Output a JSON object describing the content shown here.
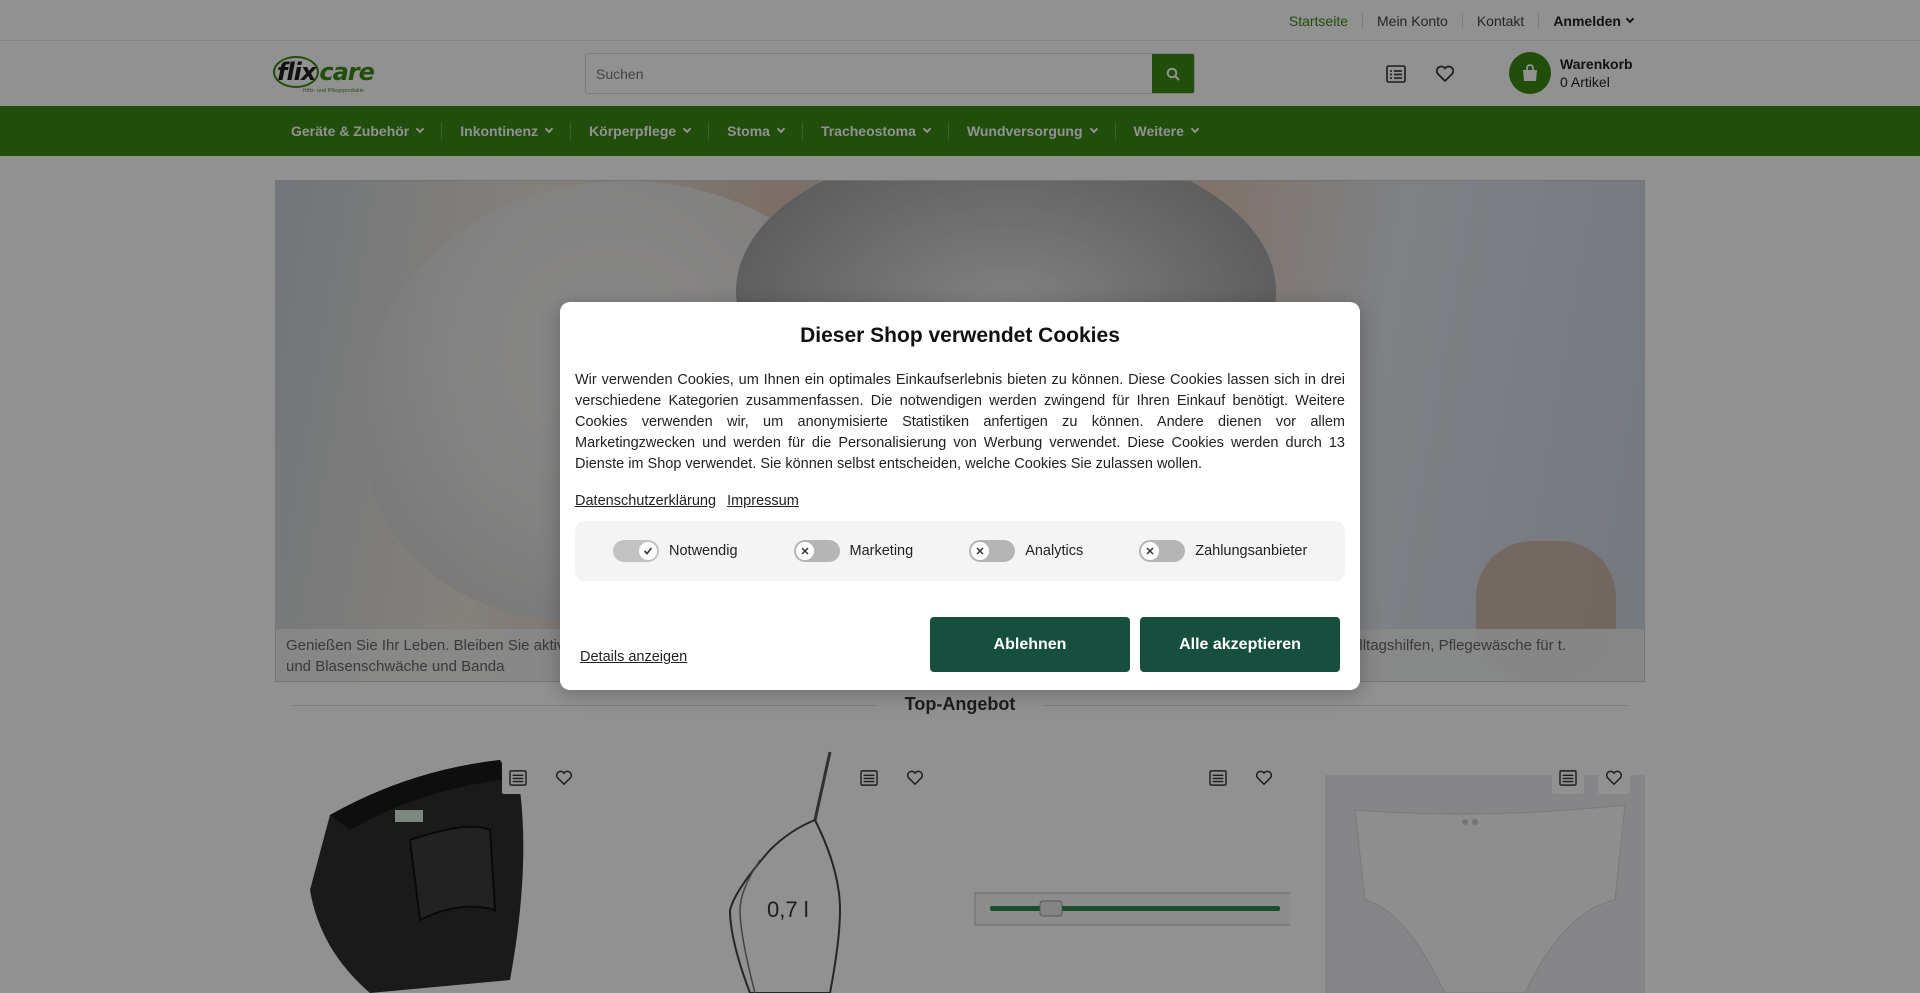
{
  "topbar": {
    "home": "Startseite",
    "account": "Mein Konto",
    "contact": "Kontakt",
    "login": "Anmelden"
  },
  "header": {
    "logo_text_1": "flix",
    "logo_text_2": "care",
    "logo_tagline": "Hilfs- und Pflegeprodukte",
    "search_placeholder": "Suchen",
    "cart_title": "Warenkorb",
    "cart_count": "0 Artikel"
  },
  "nav": {
    "items": [
      "Geräte & Zubehör",
      "Inkontinenz",
      "Körperpflege",
      "Stoma",
      "Tracheostoma",
      "Wundversorgung",
      "Weitere"
    ]
  },
  "hero": {
    "caption_left": "Genießen Sie Ihr Leben. Bleiben Sie aktiv. M Inkontinenz und Blasenschwäche und Banda",
    "caption_right": "eren Alltagshilfen, Pflegewäsche für t."
  },
  "section": {
    "top_offer": "Top-Angebot"
  },
  "products": [
    {
      "image": "black support belt"
    },
    {
      "image": "urine bag 0,7 l",
      "label": "0,7 l"
    },
    {
      "image": "catheter"
    },
    {
      "image": "incontinence briefs"
    }
  ],
  "cookie_modal": {
    "title": "Dieser Shop verwendet Cookies",
    "text": "Wir verwenden Cookies, um Ihnen ein optimales Einkaufserlebnis bieten zu können. Diese Cookies lassen sich in drei verschiedene Kategorien zusammenfassen. Die notwendigen werden zwingend für Ihren Einkauf benötigt. Weitere Cookies verwenden wir, um anonymisierte Statistiken anfertigen zu können. Andere dienen vor allem Marketingzwecken und werden für die Personalisierung von Werbung verwendet. Diese Cookies werden durch 13 Dienste im Shop verwendet. Sie können selbst entscheiden, welche Cookies Sie zulassen wollen.",
    "privacy_link": "Datenschutzerklärung",
    "imprint_link": "Impressum",
    "toggles": [
      {
        "label": "Notwendig",
        "state": "on"
      },
      {
        "label": "Marketing",
        "state": "off"
      },
      {
        "label": "Analytics",
        "state": "off"
      },
      {
        "label": "Zahlungsanbieter",
        "state": "off"
      }
    ],
    "details": "Details anzeigen",
    "reject": "Ablehnen",
    "accept": "Alle akzeptieren"
  },
  "colors": {
    "brand_green": "#3a8a14",
    "button_dark_green": "#174f3e"
  }
}
